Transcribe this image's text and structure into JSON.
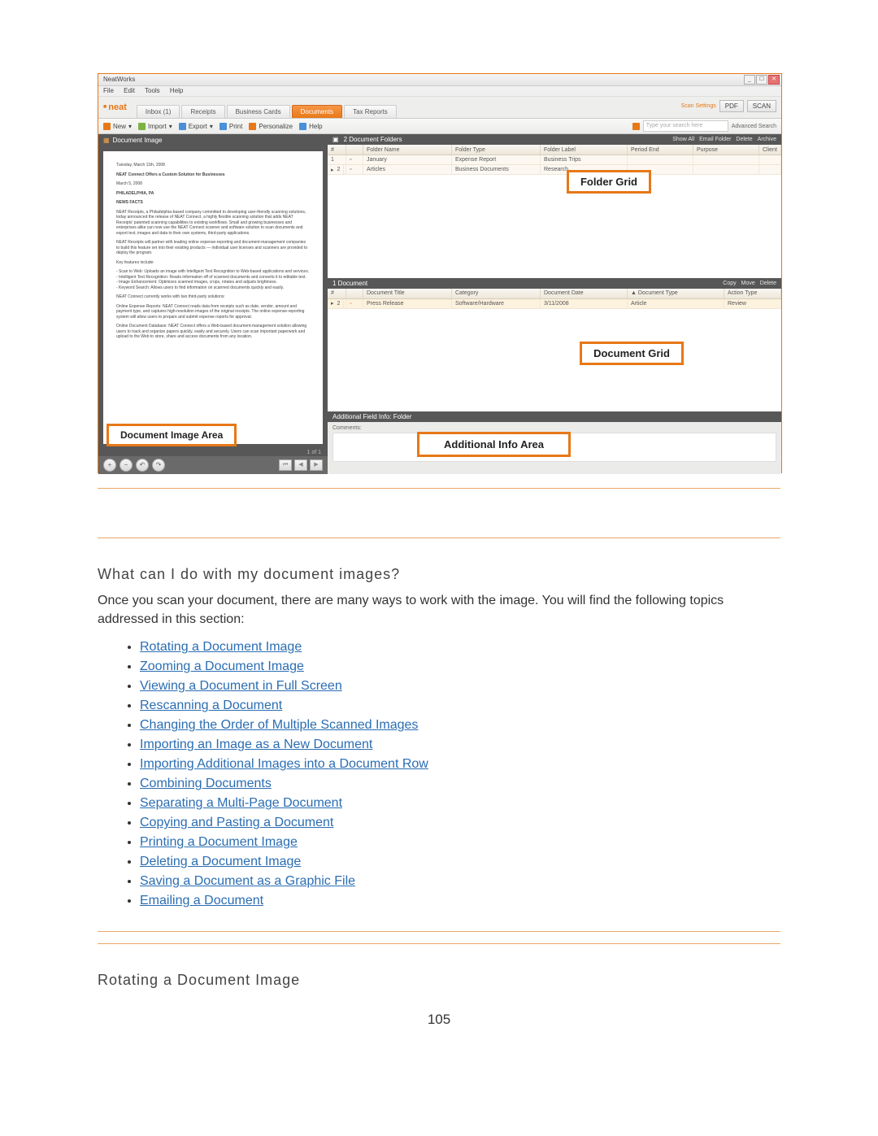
{
  "page_number": "105",
  "screenshot": {
    "window_title": "NeatWorks",
    "menubar": [
      "File",
      "Edit",
      "Tools",
      "Help"
    ],
    "brand": "neat",
    "tabs": {
      "inbox": "Inbox (1)",
      "receipts": "Receipts",
      "business_cards": "Business Cards",
      "documents": "Documents",
      "tax_reports": "Tax Reports"
    },
    "scan_settings_label": "Scan Settings",
    "pdf_button": "PDF",
    "scan_button": "SCAN",
    "toolbar": {
      "new": "New",
      "import": "Import",
      "export": "Export",
      "print": "Print",
      "personalize": "Personalize",
      "help": "Help"
    },
    "search_placeholder": "Type your search here",
    "advanced_search": "Advanced Search",
    "left_panel_title": "Document Image",
    "doc_preview": {
      "date": "Tuesday, March 11th, 2008",
      "headline": "NEAT Connect Offers a Custom Solution for Businesses",
      "date2": "March 5, 2008",
      "city": "PHILADELPHIA, PA",
      "facts_label": "NEWS FACTS",
      "p1": "NEAT Receipts, a Philadelphia-based company committed to developing user-friendly scanning solutions, today announced the release of NEAT Connect, a highly flexible scanning solution that adds NEAT Receipts' patented scanning capabilities to existing workflows. Small and growing businesses and enterprises alike can now use the NEAT Connect scanner and software solution to scan documents and export text, images and data to their own systems, third-party applications.",
      "p2": "NEAT Receipts will partner with leading online expense-reporting and document-management companies to build this feature set into their existing products — individual user licenses and scanners are provided to deploy the program.",
      "key_features_label": "Key features include:",
      "features": "- Scan to Web: Uploads an image with Intelligent Text Recognition to Web-based applications and services.\n- Intelligent Text Recognition: Reads information off of scanned documents and converts it to editable text.\n- Image Enhancement: Optimizes scanned images, crops, rotates and adjusts brightness.\n- Keyword Search: Allows users to find information on scanned documents quickly and easily.",
      "p3": "NEAT Connect currently works with two third-party solutions:",
      "p4": "Online Expense Reports: NEAT Connect reads data from receipts such as date, vendor, amount and payment type, and captures high-resolution images of the original receipts. The online expense-reporting system will allow users to prepare and submit expense reports for approval.",
      "p5": "Online Document Database: NEAT Connect offers a Web-based document-management solution allowing users to track and organize papers quickly, easily and securely. Users can scan important paperwork and upload to the Web to store, share and access documents from any location."
    },
    "page_indicator": "1 of 1",
    "callouts": {
      "image_area": "Document Image Area",
      "folder_grid": "Folder Grid",
      "document_grid": "Document Grid",
      "additional_info": "Additional Info Area"
    },
    "folder_panel": {
      "title": "2 Document Folders",
      "actions": [
        "Show All",
        "Email Folder",
        "Delete",
        "Archive"
      ],
      "columns": [
        "#",
        " ",
        "Folder Name",
        "Folder Type",
        "Folder Label",
        "Period End",
        "Purpose",
        "Client"
      ],
      "rows": [
        {
          "idx": "1",
          "name": "January",
          "type": "Expense Report",
          "label": "Business Trips"
        },
        {
          "idx": "2",
          "name": "Articles",
          "type": "Business Documents",
          "label": "Research"
        }
      ]
    },
    "document_panel": {
      "title": "1 Document",
      "actions": [
        "Copy",
        "Move",
        "Delete"
      ],
      "columns": [
        "#",
        " ",
        "Document Title",
        "Category",
        "Document Date",
        "▲ Document Type",
        "Action Type"
      ],
      "rows": [
        {
          "idx": "2",
          "title": "Press Release",
          "category": "Software/Hardware",
          "date": "3/11/2008",
          "dtype": "Article",
          "atype": "Review"
        }
      ]
    },
    "additional_panel": {
      "title": "Additional Field Info: Folder",
      "comments_label": "Comments:"
    }
  },
  "section1_heading": "What can I do with my document images?",
  "section1_body": "Once you scan your document, there are many ways to work with the image. You will find the following topics addressed in this section:",
  "links": [
    "Rotating a Document Image",
    "Zooming a Document Image",
    "Viewing a Document in Full Screen",
    "Rescanning a Document",
    "Changing the Order of Multiple Scanned Images",
    "Importing an Image as a New Document",
    "Importing Additional Images into a Document Row",
    "Combining Documents",
    "Separating a Multi-Page Document",
    "Copying and Pasting a Document",
    "Printing a Document Image",
    "Deleting a Document Image",
    "Saving a Document as a Graphic File",
    "Emailing a Document"
  ],
  "section2_heading": "Rotating a Document Image"
}
